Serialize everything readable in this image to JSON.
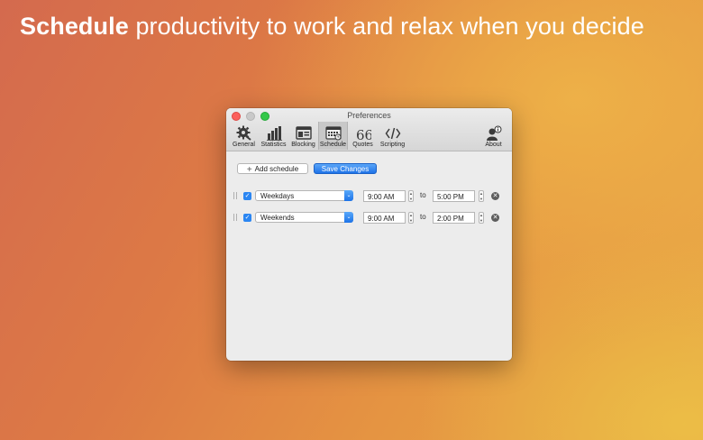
{
  "headline": {
    "bold": "Schedule",
    "rest": " productivity to work and relax when you decide"
  },
  "window": {
    "title": "Preferences"
  },
  "toolbar": {
    "items": [
      {
        "label": "General",
        "icon": "gear-icon"
      },
      {
        "label": "Statistics",
        "icon": "bar-chart-icon"
      },
      {
        "label": "Blocking",
        "icon": "browser-block-icon"
      },
      {
        "label": "Schedule",
        "icon": "calendar-icon",
        "active": true
      },
      {
        "label": "Quotes",
        "icon": "quote-icon"
      },
      {
        "label": "Scripting",
        "icon": "code-icon"
      }
    ],
    "about": {
      "label": "About",
      "icon": "person-info-icon"
    }
  },
  "actions": {
    "add_label": "Add schedule",
    "save_label": "Save Changes"
  },
  "schedules": [
    {
      "enabled": true,
      "days": "Weekdays",
      "start": "9:00 AM",
      "to": "to",
      "end": "5:00 PM"
    },
    {
      "enabled": true,
      "days": "Weekends",
      "start": "9:00 AM",
      "to": "to",
      "end": "2:00 PM"
    }
  ],
  "colors": {
    "accent": "#1f74e8",
    "close": "#fc605c",
    "maximize": "#34c84a"
  }
}
